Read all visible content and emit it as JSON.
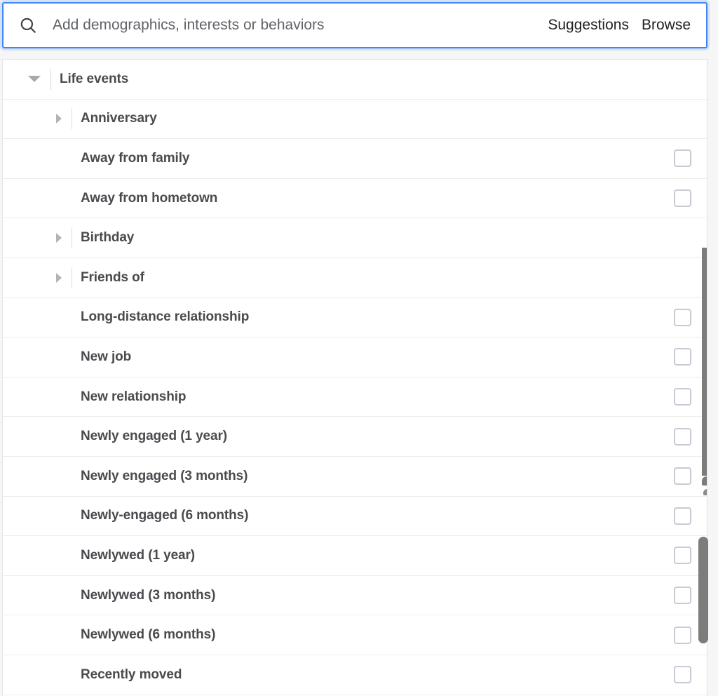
{
  "search": {
    "placeholder": "Add demographics, interests or behaviors",
    "value": "",
    "icon": "search-icon",
    "suggestions_label": "Suggestions",
    "browse_label": "Browse"
  },
  "colors": {
    "focus_ring": "#4285f4",
    "text": "#4a4a4f",
    "checkbox_border": "#c9cad3",
    "scrollbar": "#7c7c7c",
    "page_background": "#f6f6f6",
    "row_divider": "#ececec"
  },
  "list": {
    "rows": [
      {
        "label": "Life events",
        "level": 0,
        "caret": "down",
        "has_divider": true,
        "has_checkbox": false
      },
      {
        "label": "Anniversary",
        "level": 1,
        "caret": "right",
        "has_divider": true,
        "has_checkbox": false
      },
      {
        "label": "Away from family",
        "level": 1,
        "caret": "none",
        "has_divider": false,
        "has_checkbox": true
      },
      {
        "label": "Away from hometown",
        "level": 1,
        "caret": "none",
        "has_divider": false,
        "has_checkbox": true
      },
      {
        "label": "Birthday",
        "level": 1,
        "caret": "right",
        "has_divider": true,
        "has_checkbox": false
      },
      {
        "label": "Friends of",
        "level": 1,
        "caret": "right",
        "has_divider": true,
        "has_checkbox": false
      },
      {
        "label": "Long-distance relationship",
        "level": 1,
        "caret": "none",
        "has_divider": false,
        "has_checkbox": true
      },
      {
        "label": "New job",
        "level": 1,
        "caret": "none",
        "has_divider": false,
        "has_checkbox": true
      },
      {
        "label": "New relationship",
        "level": 1,
        "caret": "none",
        "has_divider": false,
        "has_checkbox": true
      },
      {
        "label": "Newly engaged (1 year)",
        "level": 1,
        "caret": "none",
        "has_divider": false,
        "has_checkbox": true
      },
      {
        "label": "Newly engaged (3 months)",
        "level": 1,
        "caret": "none",
        "has_divider": false,
        "has_checkbox": true
      },
      {
        "label": "Newly-engaged (6 months)",
        "level": 1,
        "caret": "none",
        "has_divider": false,
        "has_checkbox": true
      },
      {
        "label": "Newlywed (1 year)",
        "level": 1,
        "caret": "none",
        "has_divider": false,
        "has_checkbox": true
      },
      {
        "label": "Newlywed (3 months)",
        "level": 1,
        "caret": "none",
        "has_divider": false,
        "has_checkbox": true
      },
      {
        "label": "Newlywed (6 months)",
        "level": 1,
        "caret": "none",
        "has_divider": false,
        "has_checkbox": true
      },
      {
        "label": "Recently moved",
        "level": 1,
        "caret": "none",
        "has_divider": false,
        "has_checkbox": true
      }
    ]
  }
}
